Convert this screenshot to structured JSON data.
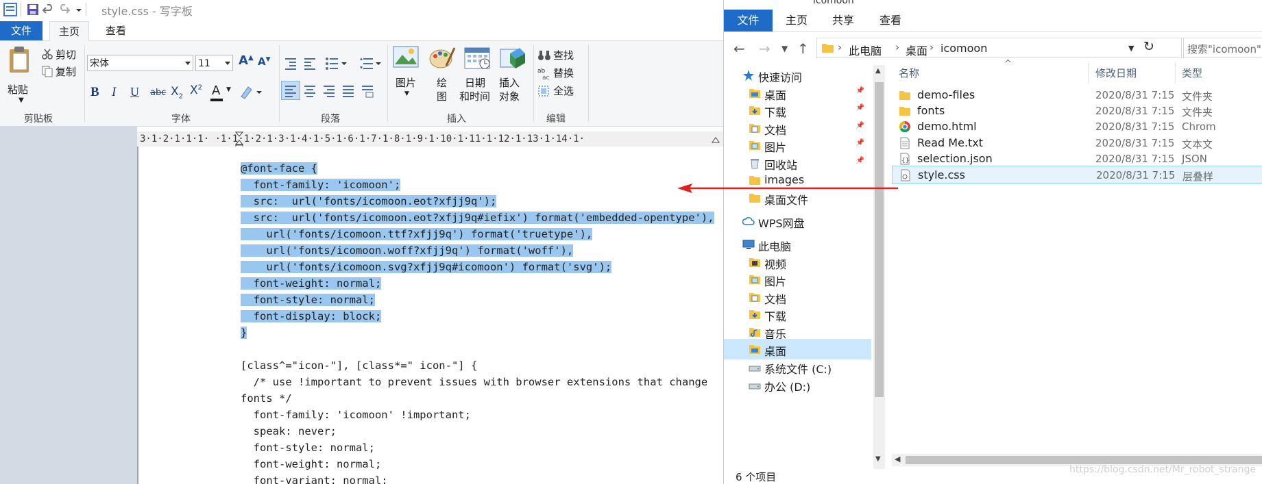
{
  "wordpad": {
    "title": "style.css - 写字板",
    "tabs": {
      "file": "文件",
      "home": "主页",
      "view": "查看"
    },
    "clipboard": {
      "paste": "粘贴",
      "cut": "剪切",
      "copy": "复制",
      "group": "剪贴板"
    },
    "font": {
      "family": "宋体",
      "size": "11",
      "group": "字体"
    },
    "paragraph": {
      "group": "段落"
    },
    "insert": {
      "picture": "图片",
      "paint_line1": "绘",
      "paint_line2": "图",
      "datetime_line1": "日期",
      "datetime_line2": "和时间",
      "object_line1": "插入",
      "object_line2": "对象",
      "group": "插入"
    },
    "editing": {
      "find": "查找",
      "replace": "替换",
      "select_all": "全选",
      "group": "编辑"
    },
    "ruler": "3·1·2·1·1·1·  ·1·1·1·2·1·3·1·4·1·5·1·6·1·7·1·8·1·9·1·10·1·11·1·12·1·13·1·14·1·",
    "code_lines": [
      {
        "text": "@font-face {",
        "selected": true
      },
      {
        "text": "  font-family: 'icomoon';",
        "selected": true
      },
      {
        "text": "  src:  url('fonts/icomoon.eot?xfjj9q');",
        "selected": true
      },
      {
        "text": "  src:  url('fonts/icomoon.eot?xfjj9q#iefix') format('embedded-opentype'),",
        "selected": true
      },
      {
        "text": "    url('fonts/icomoon.ttf?xfjj9q') format('truetype'),",
        "selected": true
      },
      {
        "text": "    url('fonts/icomoon.woff?xfjj9q') format('woff'),",
        "selected": true
      },
      {
        "text": "    url('fonts/icomoon.svg?xfjj9q#icomoon') format('svg');",
        "selected": true
      },
      {
        "text": "  font-weight: normal;",
        "selected": true
      },
      {
        "text": "  font-style: normal;",
        "selected": true
      },
      {
        "text": "  font-display: block;",
        "selected": true
      },
      {
        "text": "}",
        "selected": true
      },
      {
        "text": "",
        "selected": false
      },
      {
        "text": "[class^=\"icon-\"], [class*=\" icon-\"] {",
        "selected": false
      },
      {
        "text": "  /* use !important to prevent issues with browser extensions that change",
        "selected": false
      },
      {
        "text": "fonts */",
        "selected": false
      },
      {
        "text": "  font-family: 'icomoon' !important;",
        "selected": false
      },
      {
        "text": "  speak: never;",
        "selected": false
      },
      {
        "text": "  font-style: normal;",
        "selected": false
      },
      {
        "text": "  font-weight: normal;",
        "selected": false
      },
      {
        "text": "  font-variant: normal;",
        "selected": false
      }
    ]
  },
  "explorer": {
    "title": "icomoon",
    "tabs": {
      "file": "文件",
      "home": "主页",
      "share": "共享",
      "view": "查看"
    },
    "breadcrumb": [
      "此电脑",
      "桌面",
      "icomoon"
    ],
    "search_placeholder": "搜索\"icomoon\"",
    "sidebar": [
      {
        "label": "快速访问",
        "icon": "star-icon",
        "indent": 0,
        "pinned": false,
        "selected": false
      },
      {
        "label": "桌面",
        "icon": "desktop-folder-icon",
        "indent": 1,
        "pinned": true,
        "selected": false
      },
      {
        "label": "下载",
        "icon": "download-folder-icon",
        "indent": 1,
        "pinned": true,
        "selected": false
      },
      {
        "label": "文档",
        "icon": "documents-folder-icon",
        "indent": 1,
        "pinned": true,
        "selected": false
      },
      {
        "label": "图片",
        "icon": "pictures-folder-icon",
        "indent": 1,
        "pinned": true,
        "selected": false
      },
      {
        "label": "回收站",
        "icon": "recycle-bin-icon",
        "indent": 1,
        "pinned": true,
        "selected": false
      },
      {
        "label": "images",
        "icon": "folder-icon",
        "indent": 1,
        "pinned": false,
        "selected": false
      },
      {
        "label": "桌面文件",
        "icon": "folder-icon",
        "indent": 1,
        "pinned": false,
        "selected": false
      },
      {
        "label": "WPS网盘",
        "icon": "cloud-icon",
        "indent": 0,
        "pinned": false,
        "selected": false
      },
      {
        "label": "此电脑",
        "icon": "computer-icon",
        "indent": 0,
        "pinned": false,
        "selected": false
      },
      {
        "label": "视频",
        "icon": "videos-folder-icon",
        "indent": 1,
        "pinned": false,
        "selected": false
      },
      {
        "label": "图片",
        "icon": "pictures-folder-icon",
        "indent": 1,
        "pinned": false,
        "selected": false
      },
      {
        "label": "文档",
        "icon": "documents-folder-icon",
        "indent": 1,
        "pinned": false,
        "selected": false
      },
      {
        "label": "下载",
        "icon": "download-folder-icon",
        "indent": 1,
        "pinned": false,
        "selected": false
      },
      {
        "label": "音乐",
        "icon": "music-folder-icon",
        "indent": 1,
        "pinned": false,
        "selected": false
      },
      {
        "label": "桌面",
        "icon": "desktop-folder-icon",
        "indent": 1,
        "pinned": false,
        "selected": true
      },
      {
        "label": "系统文件 (C:)",
        "icon": "drive-icon",
        "indent": 1,
        "pinned": false,
        "selected": false
      },
      {
        "label": "办公 (D:)",
        "icon": "drive-icon",
        "indent": 1,
        "pinned": false,
        "selected": false
      }
    ],
    "columns": {
      "name": "名称",
      "date": "修改日期",
      "type": "类型"
    },
    "files": [
      {
        "name": "demo-files",
        "date": "2020/8/31 7:15",
        "type": "文件夹",
        "icon": "folder-icon"
      },
      {
        "name": "fonts",
        "date": "2020/8/31 7:15",
        "type": "文件夹",
        "icon": "folder-icon"
      },
      {
        "name": "demo.html",
        "date": "2020/8/31 7:15",
        "type": "Chrom",
        "icon": "chrome-icon"
      },
      {
        "name": "Read Me.txt",
        "date": "2020/8/31 7:15",
        "type": "文本文",
        "icon": "text-file-icon"
      },
      {
        "name": "selection.json",
        "date": "2020/8/31 7:15",
        "type": "JSON",
        "icon": "json-file-icon"
      },
      {
        "name": "style.css",
        "date": "2020/8/31 7:15",
        "type": "层叠样",
        "icon": "css-file-icon"
      }
    ],
    "status": "6 个项目"
  },
  "watermark": "https://blog.csdn.net/Mr_robot_strange",
  "colors": {
    "accent": "#1e6cc8",
    "selection": "#99c7f0",
    "arrow": "#e02020"
  }
}
